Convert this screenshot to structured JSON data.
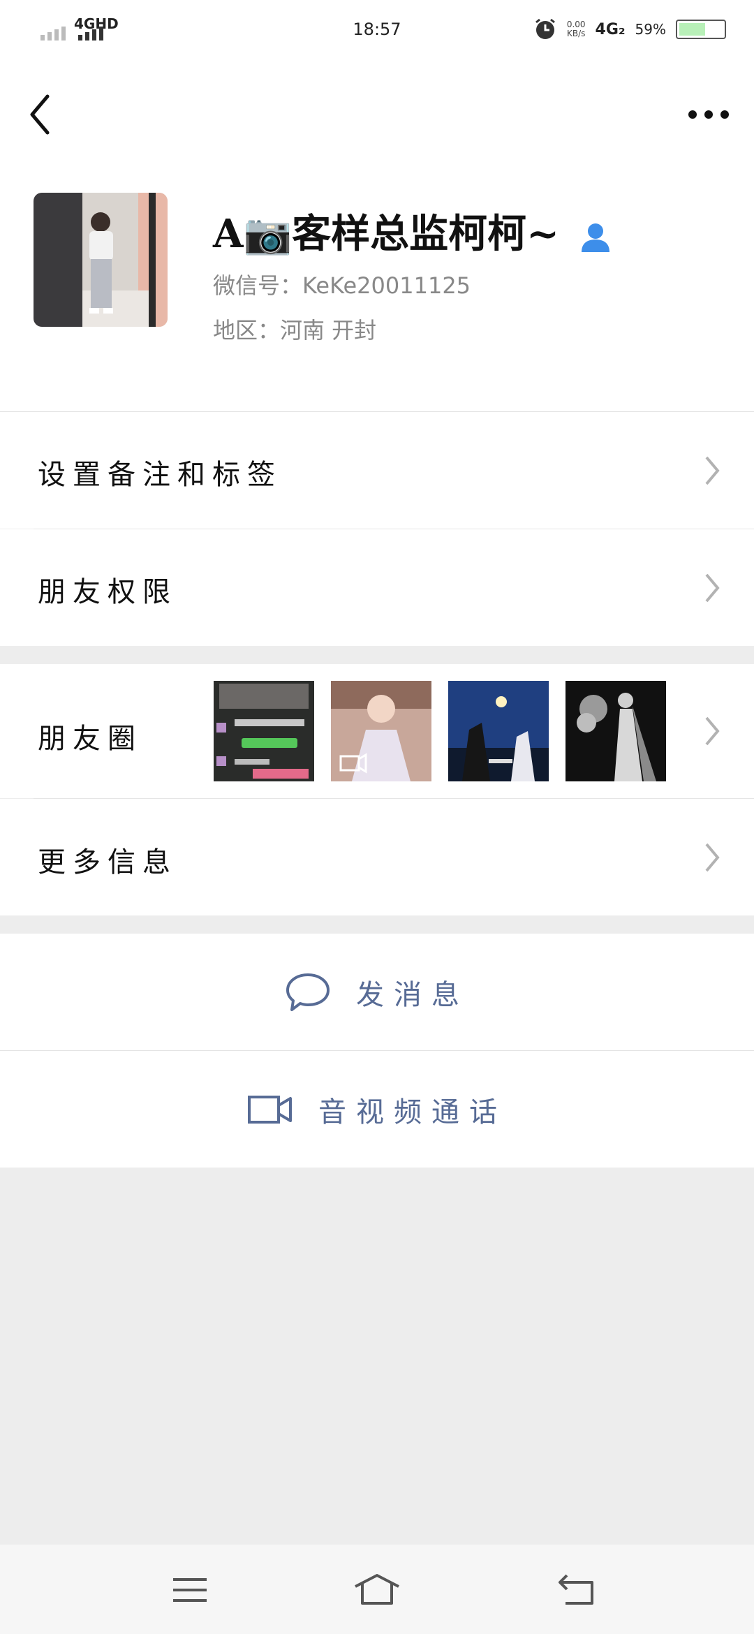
{
  "status_bar": {
    "network": "4GHD",
    "time": "18:57",
    "speed_value": "0.00",
    "speed_unit": "KB/s",
    "network_right": "4G₂",
    "battery": "59%",
    "battery_level": 0.59,
    "icons": [
      "signal-bars-icon",
      "alarm-clock-icon",
      "battery-icon"
    ]
  },
  "navbar": {
    "icons": [
      "back-arrow-icon",
      "more-dots-icon"
    ]
  },
  "profile": {
    "display_name": "A📷客样总监柯柯~",
    "wechat_id": "微信号：KeKe20011125",
    "region": "地区：河南  开封",
    "icons": [
      "avatar-photo",
      "contact-person-icon"
    ]
  },
  "menu": {
    "remarks_label": "设置备注和标签",
    "permissions_label": "朋友权限",
    "moments_label": "朋友圈",
    "more_info_label": "更多信息"
  },
  "moments_thumbnails": [
    {
      "kind": "chat-screenshot"
    },
    {
      "kind": "video",
      "icon": "video-camera-icon"
    },
    {
      "kind": "night-photo"
    },
    {
      "kind": "wedding-bw-photo"
    }
  ],
  "actions": {
    "message_label": "发消息",
    "video_call_label": "音视频通话",
    "icons": [
      "chat-bubble-icon",
      "video-camera-icon"
    ]
  },
  "system_nav": {
    "icons": [
      "menu-lines-icon",
      "home-icon",
      "return-icon"
    ]
  },
  "colors": {
    "link_blue": "#576b95",
    "background": "#ededed",
    "chevron": "#b2b2b2",
    "contact_icon": "#3d8eea"
  }
}
